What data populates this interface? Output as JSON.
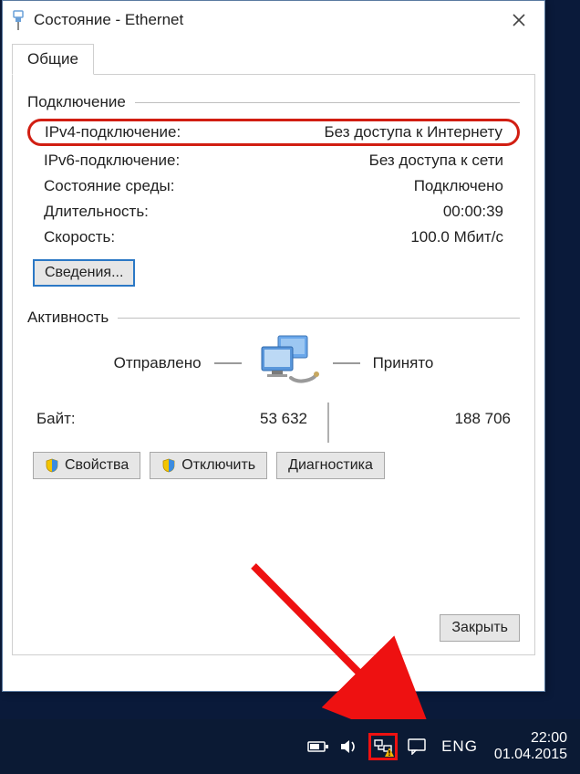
{
  "window": {
    "title": "Состояние - Ethernet",
    "tab_label": "Общие",
    "close_label": "Закрыть"
  },
  "connection": {
    "group_label": "Подключение",
    "rows": [
      {
        "label": "IPv4-подключение:",
        "value": "Без доступа к Интернету",
        "highlight": true
      },
      {
        "label": "IPv6-подключение:",
        "value": "Без доступа к сети"
      },
      {
        "label": "Состояние среды:",
        "value": "Подключено"
      },
      {
        "label": "Длительность:",
        "value": "00:00:39"
      },
      {
        "label": "Скорость:",
        "value": "100.0 Мбит/с"
      }
    ],
    "details_button": "Сведения..."
  },
  "activity": {
    "group_label": "Активность",
    "sent_label": "Отправлено",
    "recv_label": "Принято",
    "bytes_label": "Байт:",
    "sent_bytes": "53 632",
    "recv_bytes": "188 706"
  },
  "action_buttons": {
    "properties": "Свойства",
    "disable": "Отключить",
    "diagnose": "Диагностика"
  },
  "taskbar": {
    "lang": "ENG",
    "time": "22:00",
    "date": "01.04.2015"
  }
}
